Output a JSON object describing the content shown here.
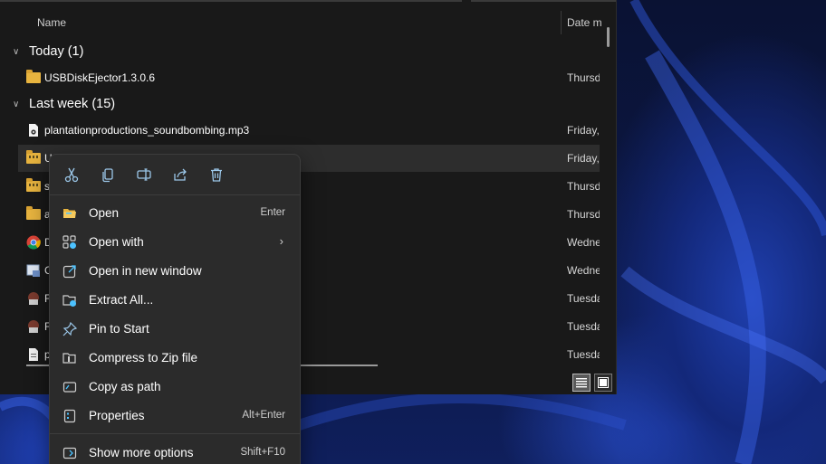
{
  "columns": {
    "name": "Name",
    "date": "Date m"
  },
  "groups": [
    {
      "label": "Today (1)"
    },
    {
      "label": "Last week (15)"
    }
  ],
  "files": [
    {
      "name": "USBDiskEjector1.3.0.6",
      "date": "Thursd",
      "icon": "folder-icon"
    },
    {
      "name": "plantationproductions_soundbombing.mp3",
      "date": "Friday,",
      "icon": "audio-file-icon"
    },
    {
      "name": "U",
      "date": "Friday,",
      "icon": "zip-folder-icon"
    },
    {
      "name": "s",
      "date": "Thursd",
      "icon": "zip-folder-icon"
    },
    {
      "name": "a",
      "date": "Thursd",
      "icon": "folder-icon"
    },
    {
      "name": "D",
      "date": "Wedne",
      "icon": "chrome-icon"
    },
    {
      "name": "C",
      "date": "Wedne",
      "icon": "installer-icon"
    },
    {
      "name": "F",
      "date": "Tuesda",
      "icon": "app-icon"
    },
    {
      "name": "F",
      "date": "Tuesda",
      "icon": "app-icon"
    },
    {
      "name": "p",
      "date": "Tuesda",
      "icon": "document-icon"
    }
  ],
  "context_menu": {
    "quick_actions": [
      "cut-icon",
      "copy-icon",
      "rename-icon",
      "share-icon",
      "delete-icon"
    ],
    "items": [
      {
        "label": "Open",
        "shortcut": "Enter",
        "icon": "open-folder-icon"
      },
      {
        "label": "Open with",
        "shortcut": "",
        "icon": "open-with-icon",
        "submenu": "›"
      },
      {
        "label": "Open in new window",
        "shortcut": "",
        "icon": "new-window-icon"
      },
      {
        "label": "Extract All...",
        "shortcut": "",
        "icon": "extract-icon"
      },
      {
        "label": "Pin to Start",
        "shortcut": "",
        "icon": "pin-icon"
      },
      {
        "label": "Compress to Zip file",
        "shortcut": "",
        "icon": "compress-icon"
      },
      {
        "label": "Copy as path",
        "shortcut": "",
        "icon": "copy-path-icon"
      },
      {
        "label": "Properties",
        "shortcut": "Alt+Enter",
        "icon": "properties-icon"
      }
    ],
    "more": {
      "label": "Show more options",
      "shortcut": "Shift+F10",
      "icon": "more-options-icon"
    }
  },
  "colors": {
    "accent": "#4cc2ff",
    "folder": "#e8b43f"
  }
}
